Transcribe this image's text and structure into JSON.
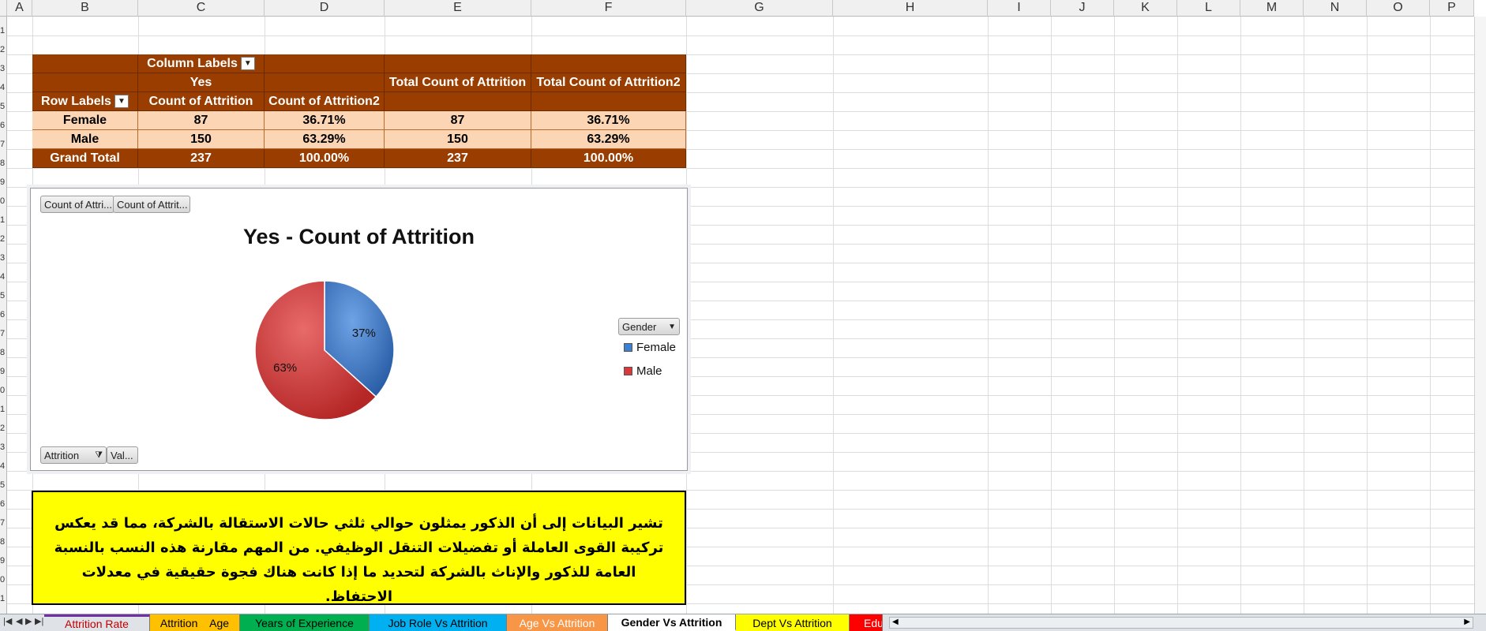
{
  "columns": [
    "A",
    "B",
    "C",
    "D",
    "E",
    "F",
    "G",
    "H",
    "I",
    "J",
    "K",
    "L",
    "M",
    "N",
    "O",
    "P"
  ],
  "row_numbers": [
    "1",
    "2",
    "3",
    "4",
    "5",
    "6",
    "7",
    "8",
    "9",
    "0",
    "1",
    "2",
    "3",
    "4",
    "5",
    "6",
    "7",
    "8",
    "9",
    "0",
    "1",
    "2",
    "3",
    "4",
    "5",
    "6",
    "7",
    "8",
    "9",
    "0",
    "1",
    "2"
  ],
  "pivot": {
    "column_labels": "Column Labels",
    "yes": "Yes",
    "total_count": "Total Count of Attrition",
    "total_count2": "Total Count of Attrition2",
    "row_labels": "Row Labels",
    "count": "Count of Attrition",
    "count2": "Count of Attrition2",
    "rows": [
      {
        "label": "Female",
        "count": "87",
        "pct": "36.71%",
        "total": "87",
        "total_pct": "36.71%"
      },
      {
        "label": "Male",
        "count": "150",
        "pct": "63.29%",
        "total": "150",
        "total_pct": "63.29%"
      },
      {
        "label": "Grand Total",
        "count": "237",
        "pct": "100.00%",
        "total": "237",
        "total_pct": "100.00%"
      }
    ]
  },
  "chart": {
    "field_btn_1": "Count of Attri...",
    "field_btn_2": "Count of Attrit...",
    "axis_btn": "Attrition",
    "values_btn": "Val...",
    "legend_btn": "Gender",
    "female_label": "37%",
    "male_label": "63%"
  },
  "chart_data": {
    "type": "pie",
    "title": "Yes - Count of Attrition",
    "categories": [
      "Female",
      "Male"
    ],
    "values": [
      87,
      150
    ],
    "percent_labels": [
      "37%",
      "63%"
    ],
    "colors": [
      "#3d7fd1",
      "#d73a3a"
    ],
    "legend_position": "right"
  },
  "note_text": "تشير البيانات إلى أن الذكور يمثلون حوالي ثلثي حالات الاستقالة بالشركة، مما قد يعكس تركيبة القوى العاملة أو تفضيلات التنقل الوظيفي. من المهم مقارنة هذه النسب بالنسبة العامة للذكور والإناث بالشركة لتحديد ما إذا كانت هناك فجوة حقيقية في معدلات الاحتفاظ.",
  "tabs": [
    {
      "label": "Attrition Rate",
      "color": "#7030a0"
    },
    {
      "label": "Attrition    Age",
      "color": "#ffc000"
    },
    {
      "label": "Years of Experience",
      "color": "#00b050"
    },
    {
      "label": "Job Role Vs Attrition",
      "color": "#00b0f0"
    },
    {
      "label": "Age Vs Attrition",
      "color": "#f79646"
    },
    {
      "label": "Gender Vs Attrition",
      "color": "#ffffff"
    },
    {
      "label": "Dept Vs Attrition",
      "color": "#ffff00"
    },
    {
      "label": "Edu",
      "color": "#ff0000"
    }
  ],
  "nav_icons": [
    "first-sheet-icon",
    "prev-sheet-icon",
    "next-sheet-icon",
    "last-sheet-icon"
  ]
}
